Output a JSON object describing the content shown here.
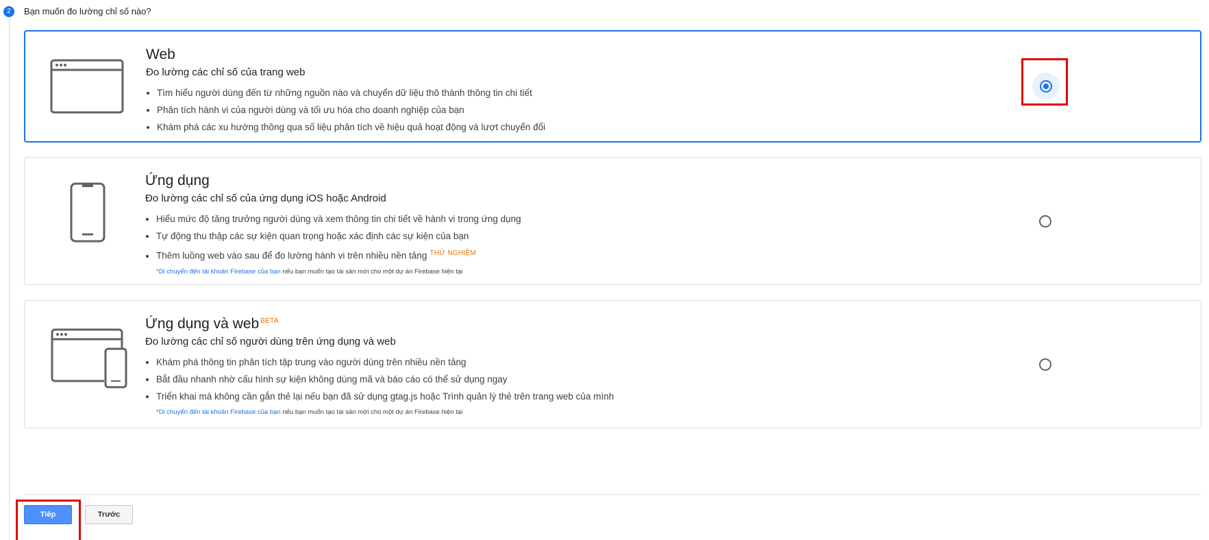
{
  "step": {
    "number": "2",
    "title": "Bạn muốn đo lường chỉ số nào?"
  },
  "options": [
    {
      "title": "Web",
      "subtitle": "Đo lường các chỉ số của trang web",
      "bullets": [
        "Tìm hiểu người dùng đến từ những nguồn nào và chuyển dữ liệu thô thành thông tin chi tiết",
        "Phân tích hành vi của người dùng và tối ưu hóa cho doanh nghiệp của bạn",
        "Khám phá các xu hướng thông qua số liệu phân tích về hiệu quả hoạt động và lượt chuyển đổi"
      ],
      "selected": true,
      "icon": "browser-window-icon"
    },
    {
      "title": "Ứng dụng",
      "subtitle": "Đo lường các chỉ số của ứng dụng iOS hoặc Android",
      "bullets": [
        "Hiểu mức độ tăng trưởng người dùng và xem thông tin chi tiết về hành vi trong ứng dụng",
        "Tự động thu thập các sự kiện quan trọng hoặc xác định các sự kiện của bạn",
        "Thêm luồng web vào sau để đo lường hành vi trên nhiều nền tảng"
      ],
      "bullet3_tag": "THỬ NGHIỆM",
      "note_link": "*Di chuyển đến tài khoản Firebase của bạn",
      "note_text": " nếu bạn muốn tạo tài sản mới cho một dự án Firebase hiện tại",
      "selected": false,
      "icon": "mobile-phone-icon"
    },
    {
      "title": "Ứng dụng và web",
      "title_tag": "BETA",
      "subtitle": "Đo lường các chỉ số người dùng trên ứng dụng và web",
      "bullets": [
        "Khám phá thông tin phân tích tập trung vào người dùng trên nhiều nền tảng",
        "Bắt đầu nhanh nhờ cấu hình sự kiện không dùng mã và báo cáo có thể sử dụng ngay",
        "Triển khai mà không cần gắn thẻ lại nếu bạn đã sử dụng gtag.js hoặc Trình quản lý thẻ trên trang web của mình"
      ],
      "note_link": "*Di chuyển đến tài khoản Firebase của bạn",
      "note_text": " nếu bạn muốn tạo tài sản mới cho một dự án Firebase hiện tại",
      "selected": false,
      "icon": "browser-and-phone-icon"
    }
  ],
  "buttons": {
    "next": "Tiếp",
    "previous": "Trước"
  },
  "colors": {
    "accent": "#1a73e8",
    "highlight": "#e00000",
    "tag": "#e37400",
    "primary_button": "#4d90fe"
  }
}
